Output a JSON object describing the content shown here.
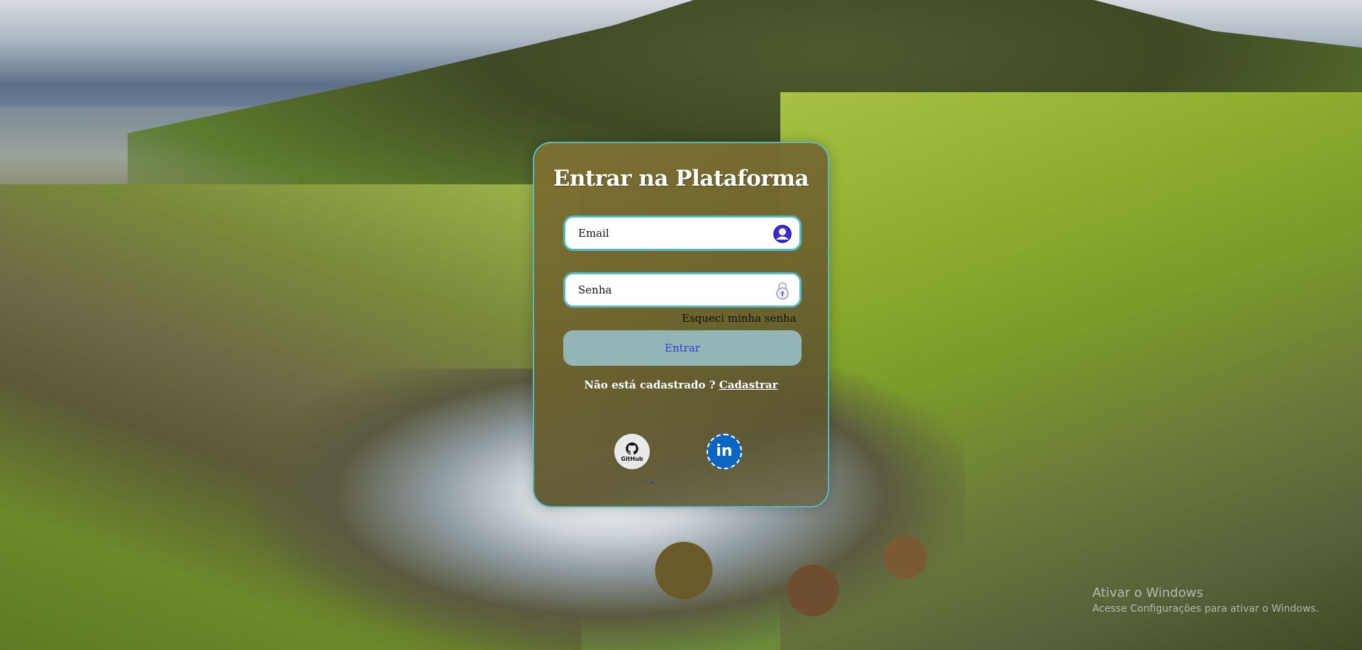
{
  "login": {
    "title": "Entrar na Plataforma",
    "email_placeholder": "Email",
    "senha_placeholder": "Senha",
    "forgot_link": "Esqueci minha senha",
    "submit_label": "Entrar",
    "signup_prompt": "Não está cadastrado ?",
    "signup_link": "Cadastrar"
  },
  "social": {
    "github_label": "GitHub",
    "linkedin_label": "in"
  },
  "windows_watermark": {
    "line1": "Ativar o Windows",
    "line2": "Acesse Configurações para ativar o Windows."
  },
  "colors": {
    "accent": "#56b8c4",
    "button": "#93b5b6",
    "button_text": "#2f3fd6",
    "linkedin": "#0a66c2"
  },
  "icons": {
    "email": "user-icon",
    "senha": "lock-icon",
    "github": "github-icon",
    "linkedin": "linkedin-icon"
  }
}
